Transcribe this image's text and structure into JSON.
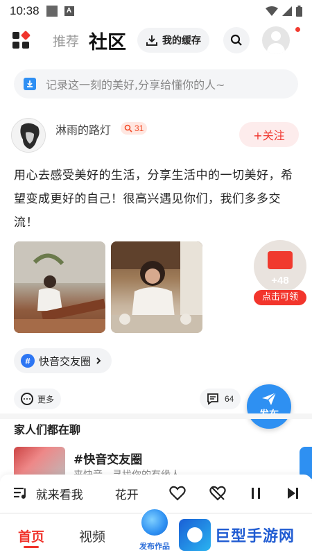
{
  "status_bar": {
    "time": "10:38",
    "badge_letter": "A"
  },
  "top_nav": {
    "tab_recommend": "推荐",
    "tab_community": "社区",
    "cache_label": "我的缓存"
  },
  "composer": {
    "placeholder": "记录这一刻的美好,分享给懂你的人~"
  },
  "post": {
    "username": "淋雨的路灯",
    "level": "31",
    "follow_label": "+关注",
    "text": "用心去感受美好的生活，分享生活中的一切美好，希望变成更好的自己！很高兴遇见你们，我们多多交流！",
    "topic": "快音交友圈",
    "more_label": "更多",
    "comment_count": "64"
  },
  "red_packet": {
    "amount": "+48",
    "cta": "点击可领"
  },
  "publish_fab": {
    "label": "发布"
  },
  "section": {
    "title": "家人们都在聊",
    "group_title": "#快音交友圈",
    "group_desc": "来快音，寻找你的有缘人"
  },
  "music_bar": {
    "text1": "就来看我",
    "text2": "花开"
  },
  "bottom_nav": {
    "home": "首页",
    "video": "视频",
    "publish": "发布作品"
  },
  "watermark": {
    "text": "巨型手游网"
  },
  "colors": {
    "accent_red": "#f0342c",
    "accent_blue": "#2e90f2"
  }
}
